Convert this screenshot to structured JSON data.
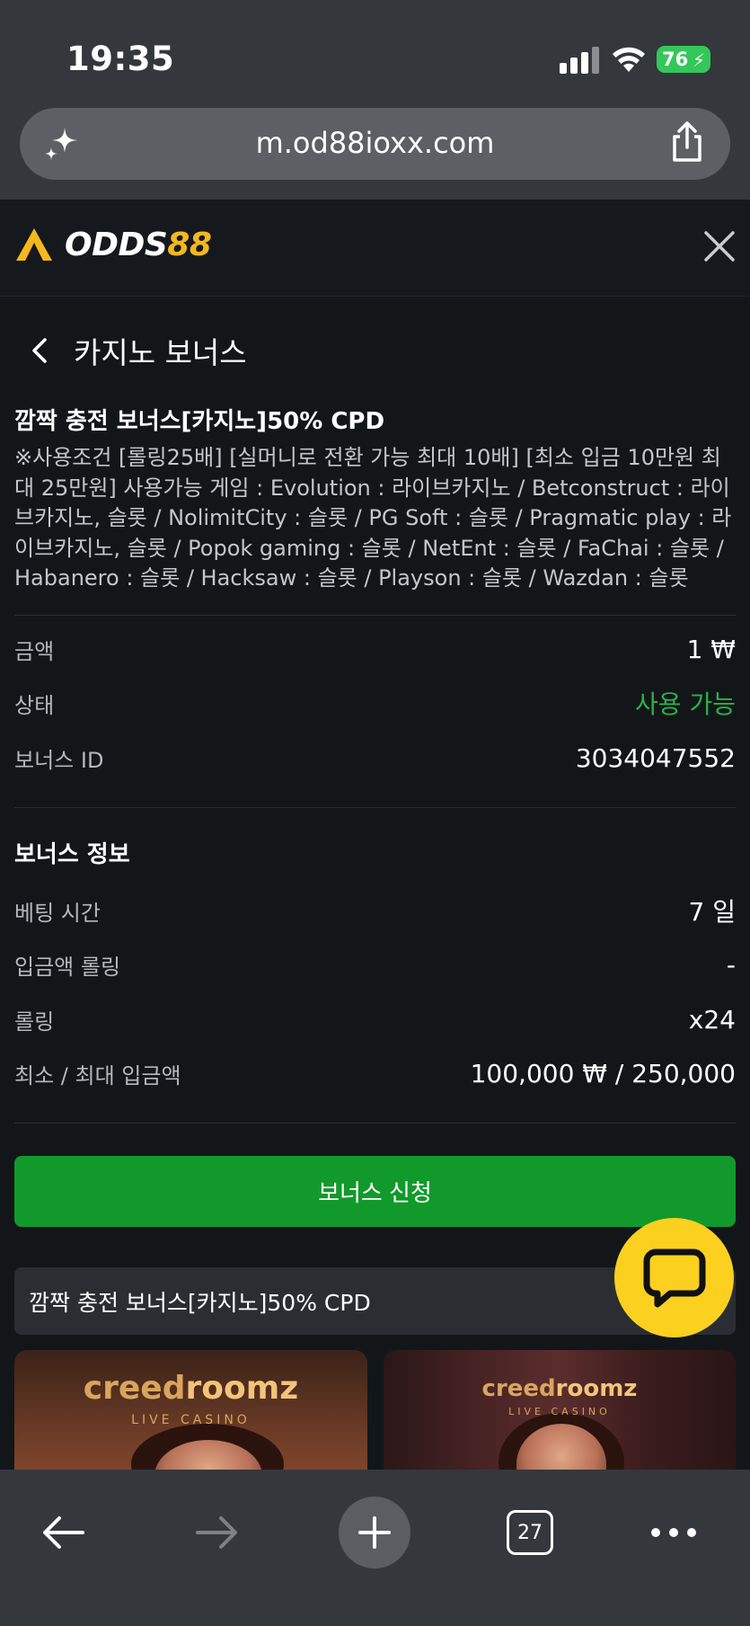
{
  "status_bar": {
    "time": "19:35",
    "battery": "76"
  },
  "browser": {
    "url": "m.od88ioxx.com",
    "tabs_count": "27"
  },
  "header": {
    "logo_text_1": "ODDS",
    "logo_text_2": "88"
  },
  "page": {
    "title": "카지노 보너스",
    "bonus_title": "깜짝 충전 보너스[카지노]50% CPD",
    "bonus_description": "※사용조건 [롤링25배] [실머니로 전환 가능 최대 10배] [최소 입금 10만원 최대 25만원] 사용가능 게임 : Evolution : 라이브카지노 / Betconstruct : 라이브카지노, 슬롯 / NolimitCity : 슬롯 / PG Soft : 슬롯 / Pragmatic play : 라이브카지노, 슬롯 / Popok gaming : 슬롯 / NetEnt : 슬롯 / FaChai : 슬롯 / Habanero : 슬롯 / Hacksaw : 슬롯 / Playson : 슬롯 / Wazdan : 슬롯",
    "details": [
      {
        "label": "금액",
        "value": "1 ₩"
      },
      {
        "label": "상태",
        "value": "사용 가능"
      },
      {
        "label": "보너스 ID",
        "value": "3034047552"
      }
    ],
    "info_section_title": "보너스 정보",
    "info": [
      {
        "label": "베팅 시간",
        "value": "7 일"
      },
      {
        "label": "입금액 롤링",
        "value": "-"
      },
      {
        "label": "롤링",
        "value": "x24"
      },
      {
        "label": "최소 / 최대 입금액",
        "value": "100,000 ₩ / 250,000"
      }
    ],
    "apply_button": "보너스 신청",
    "promo_card": "깜짝 충전 보너스[카지노]50% CPD",
    "game_tiles": [
      {
        "brand_a": "creed",
        "brand_b": "roomz",
        "sub": "LIVE CASINO"
      },
      {
        "brand_a": "creed",
        "brand_b": "roomz",
        "sub": "LIVE CASINO"
      }
    ]
  },
  "colors": {
    "accent_green": "#12992b",
    "status_green": "#2bb14a",
    "logo_gold": "#f4b71e",
    "chat_yellow": "#fbd01f"
  }
}
